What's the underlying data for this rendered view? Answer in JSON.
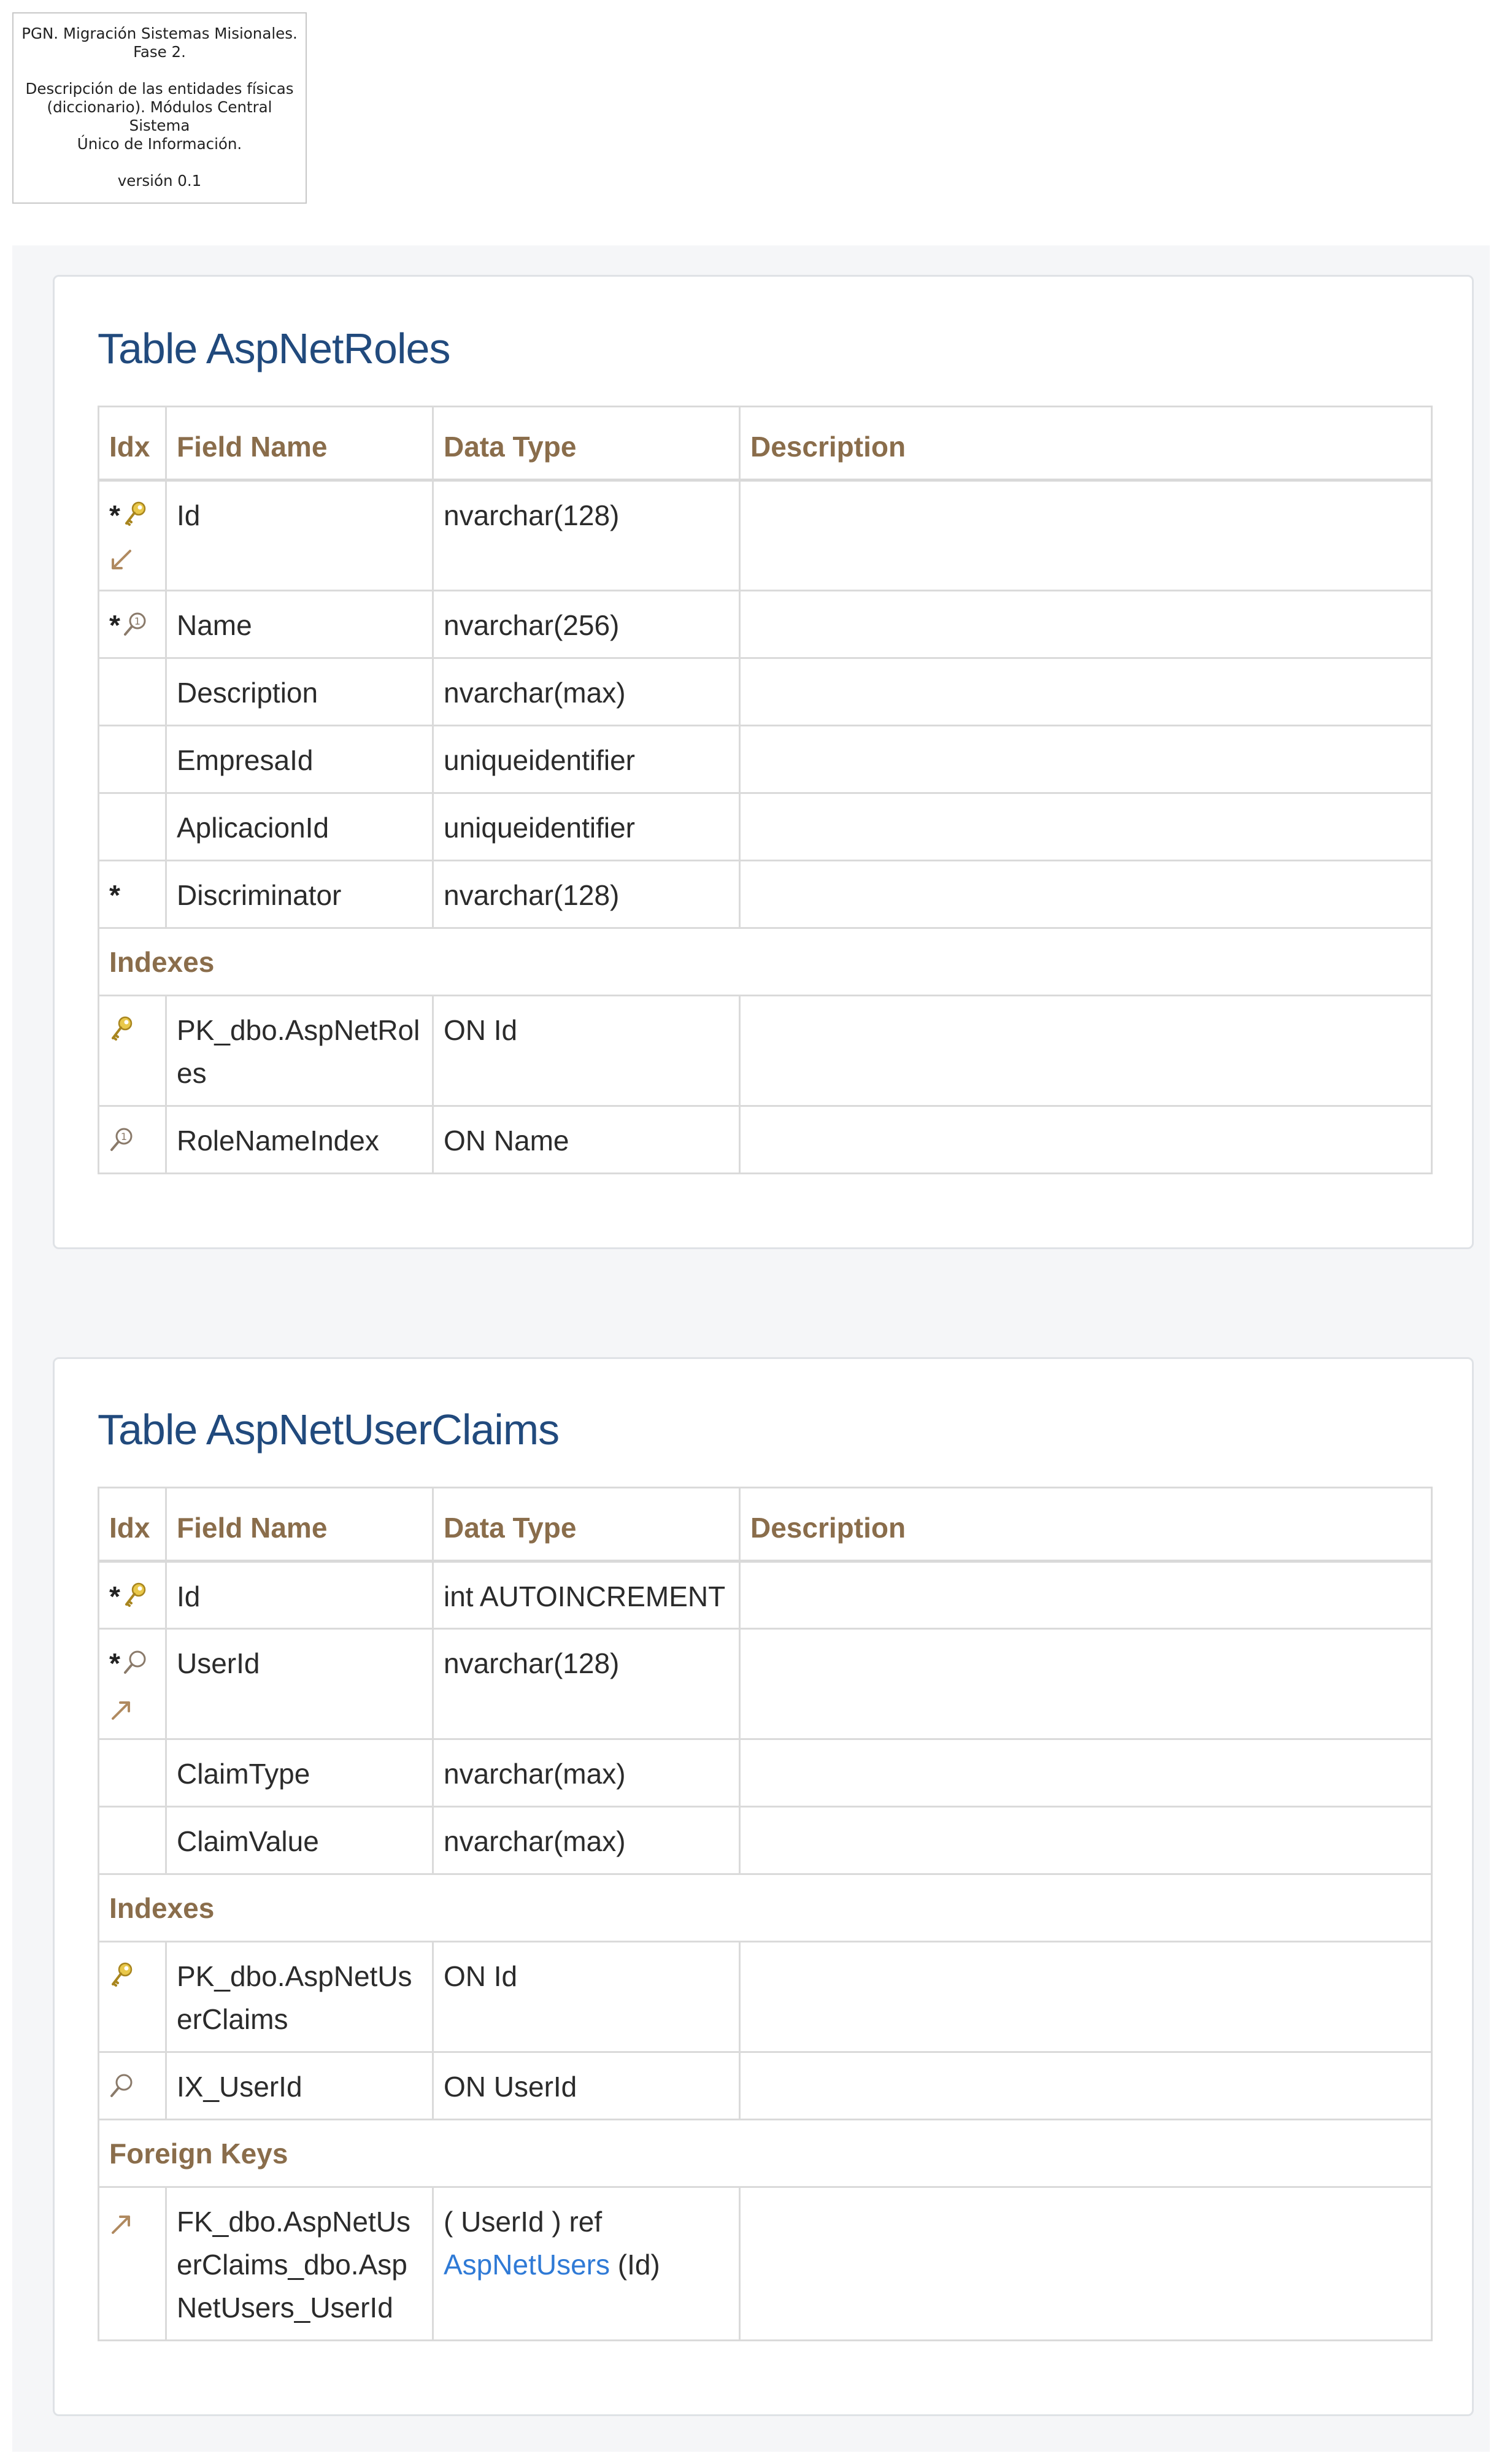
{
  "header": {
    "line1": "PGN. Migración Sistemas Misionales.",
    "line2": "Fase 2.",
    "line3": "Descripción de las entidades físicas",
    "line4": "(diccionario). Módulos Central Sistema",
    "line5": "Único de Información.",
    "line6": "versión 0.1"
  },
  "columns": {
    "idx": "Idx",
    "field": "Field Name",
    "type": "Data Type",
    "desc": "Description"
  },
  "sections": {
    "indexes": "Indexes",
    "foreign_keys": "Foreign Keys"
  },
  "tables": [
    {
      "title": "Table AspNetRoles",
      "fields": [
        {
          "name": "Id",
          "type": "nvarchar(128)",
          "required": "*",
          "icons": [
            "key-icon",
            "fk-incoming-icon"
          ]
        },
        {
          "name": "Name",
          "type": "nvarchar(256)",
          "required": "*",
          "icons": [
            "unique-index-icon"
          ]
        },
        {
          "name": "Description",
          "type": "nvarchar(max)"
        },
        {
          "name": "EmpresaId",
          "type": "uniqueidentifier"
        },
        {
          "name": "AplicacionId",
          "type": "uniqueidentifier"
        },
        {
          "name": "Discriminator",
          "type": "nvarchar(128)",
          "required": "*"
        }
      ],
      "indexes": [
        {
          "name": "PK_dbo.AspNetRoles",
          "on": "ON Id",
          "icon": "key-icon"
        },
        {
          "name": "RoleNameIndex",
          "on": "ON Name",
          "icon": "unique-index-icon"
        }
      ]
    },
    {
      "title": "Table AspNetUserClaims",
      "fields": [
        {
          "name": "Id",
          "type": "int AUTOINCREMENT",
          "required": "*",
          "icons": [
            "key-icon"
          ]
        },
        {
          "name": "UserId",
          "type": "nvarchar(128)",
          "required": "*",
          "icons": [
            "index-icon",
            "fk-outgoing-icon"
          ]
        },
        {
          "name": "ClaimType",
          "type": "nvarchar(max)"
        },
        {
          "name": "ClaimValue",
          "type": "nvarchar(max)"
        }
      ],
      "indexes": [
        {
          "name": "PK_dbo.AspNetUserClaims",
          "on": "ON Id",
          "icon": "key-icon"
        },
        {
          "name": "IX_UserId",
          "on": "ON UserId",
          "icon": "index-icon"
        }
      ],
      "foreign_keys": [
        {
          "name": "FK_dbo.AspNetUserClaims_dbo.AspNetUsers_UserId",
          "ref_prefix": "( UserId ) ref",
          "ref_table": "AspNetUsers",
          "ref_suffix": "(Id)",
          "icon": "fk-outgoing-icon"
        }
      ]
    }
  ]
}
